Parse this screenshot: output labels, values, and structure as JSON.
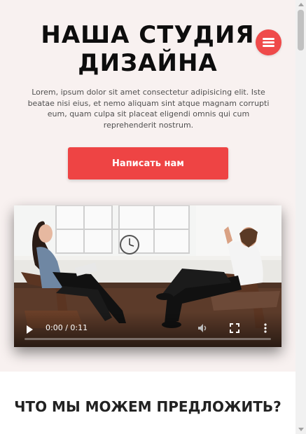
{
  "hero": {
    "title": "НАША СТУДИЯ ДИЗАЙНА",
    "text": "Lorem, ipsum dolor sit amet consectetur adipisicing elit. Iste beatae nisi eius, et nemo aliquam sint atque magnam corrupti eum, quam culpa sit placeat eligendi omnis qui cum reprehenderit nostrum.",
    "cta_label": "Написать нам"
  },
  "menu": {
    "icon": "hamburger-icon"
  },
  "video": {
    "time": "0:00 / 0:11",
    "progress": 0.0,
    "icons": [
      "play-icon",
      "volume-icon",
      "fullscreen-icon",
      "more-options-icon"
    ]
  },
  "services": {
    "title": "ЧТО МЫ МОЖЕМ ПРЕДЛОЖИТЬ?"
  },
  "colors": {
    "accent": "#ee4444",
    "background": "#f8f1f0",
    "title": "#0d0d0d"
  }
}
